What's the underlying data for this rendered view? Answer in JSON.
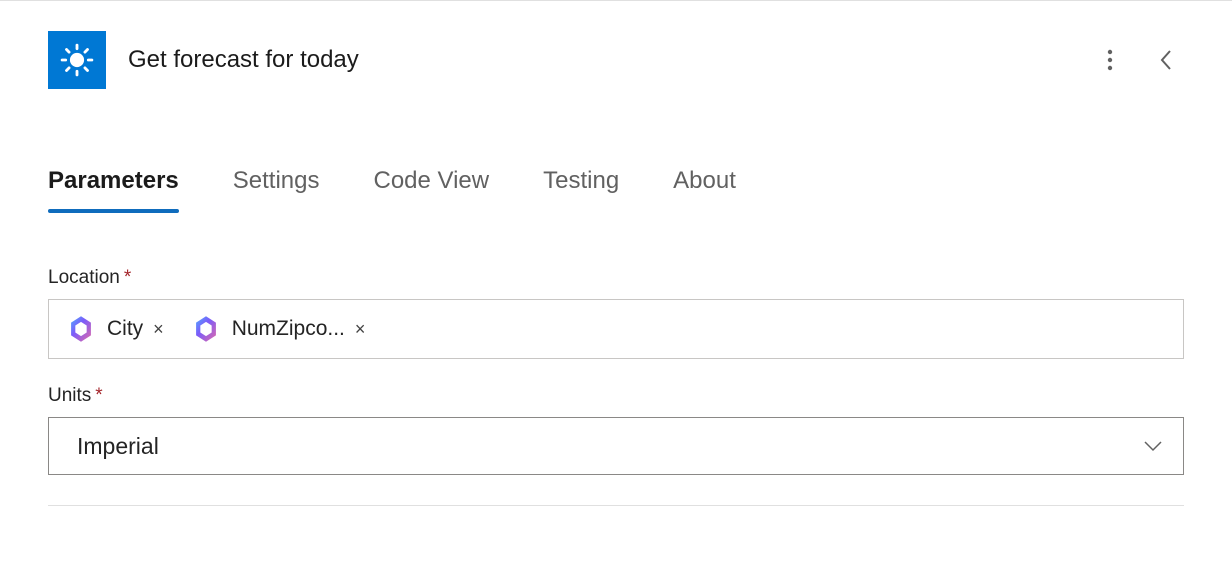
{
  "header": {
    "title": "Get forecast for today",
    "icon": "sun-icon",
    "icon_bg": "#0078d4"
  },
  "tabs": [
    {
      "label": "Parameters",
      "active": true
    },
    {
      "label": "Settings",
      "active": false
    },
    {
      "label": "Code View",
      "active": false
    },
    {
      "label": "Testing",
      "active": false
    },
    {
      "label": "About",
      "active": false
    }
  ],
  "fields": {
    "location": {
      "label": "Location",
      "required": true,
      "tokens": [
        {
          "label": "City",
          "icon": "copilot-icon"
        },
        {
          "label": "NumZipco...",
          "icon": "copilot-icon"
        }
      ]
    },
    "units": {
      "label": "Units",
      "required": true,
      "value": "Imperial"
    }
  }
}
